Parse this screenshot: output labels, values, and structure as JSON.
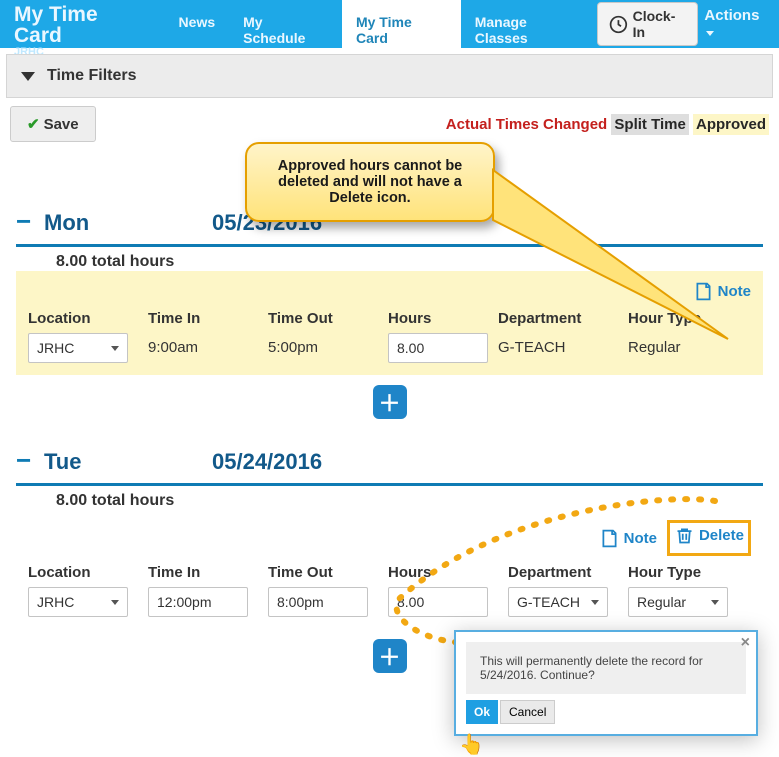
{
  "brand": {
    "title": "My Time Card",
    "sub": "JRHC"
  },
  "nav": {
    "news": "News",
    "schedule": "My Schedule",
    "timecard": "My Time Card",
    "classes": "Manage Classes",
    "clockin": "Clock-In",
    "actions": "Actions"
  },
  "filters": {
    "label": "Time Filters"
  },
  "toolbar": {
    "save": "Save"
  },
  "legend": {
    "actual": "Actual Times Changed",
    "split": "Split Time",
    "approved": "Approved"
  },
  "callout": {
    "text": "Approved hours cannot be deleted and will not have a Delete icon."
  },
  "cols": {
    "location": "Location",
    "timein": "Time In",
    "timeout": "Time Out",
    "hours": "Hours",
    "department": "Department",
    "hourtype": "Hour Type"
  },
  "links": {
    "note": "Note",
    "delete": "Delete"
  },
  "days": [
    {
      "name": "Mon",
      "date": "05/23/2016",
      "total": "8.00 total hours",
      "approved": true,
      "entry": {
        "location": "JRHC",
        "timein": "9:00am",
        "timeout": "5:00pm",
        "hours": "8.00",
        "department": "G-TEACH",
        "hourtype": "Regular"
      }
    },
    {
      "name": "Tue",
      "date": "05/24/2016",
      "total": "8.00 total hours",
      "approved": false,
      "entry": {
        "location": "JRHC",
        "timein": "12:00pm",
        "timeout": "8:00pm",
        "hours": "8.00",
        "department": "G-TEACH",
        "hourtype": "Regular"
      }
    }
  ],
  "dialog": {
    "message": "This will permanently delete the record for 5/24/2016. Continue?",
    "ok": "Ok",
    "cancel": "Cancel"
  }
}
